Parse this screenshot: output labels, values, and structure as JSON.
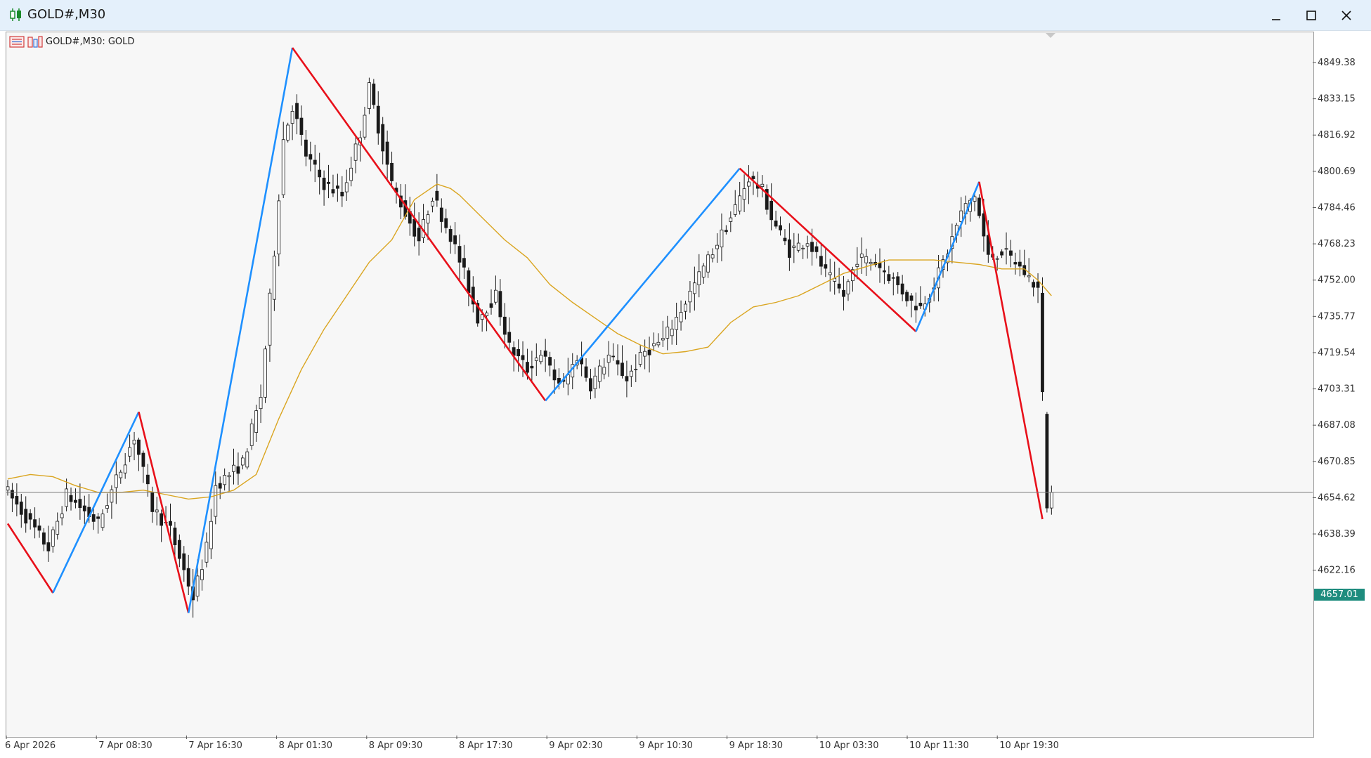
{
  "window": {
    "title": "GOLD#,M30",
    "icon": "candlestick-icon",
    "controls": [
      "minimize-icon",
      "maximize-icon",
      "close-icon"
    ]
  },
  "chart_header": {
    "label": "GOLD#,M30:  GOLD",
    "icons": [
      "one-click-trading-icon",
      "market-depth-icon"
    ]
  },
  "current_price": "4657.01",
  "colors": {
    "bull_body": "#ffffff",
    "bear_body": "#1a1a1a",
    "wick": "#1a1a1a",
    "zigzag_up": "#1e90ff",
    "zigzag_down": "#e8101a",
    "moving_average": "#daa520",
    "price_line": "#7a7a7a",
    "price_tag": "#1e8c7e",
    "background": "#f7f7f7"
  },
  "chart_data": {
    "type": "candlestick",
    "symbol": "GOLD#",
    "timeframe": "M30",
    "ylim": [
      4605,
      4859
    ],
    "y_ticks": [
      "4849.38",
      "4833.15",
      "4816.92",
      "4800.69",
      "4784.46",
      "4768.23",
      "4752.00",
      "4735.77",
      "4719.54",
      "4703.31",
      "4687.08",
      "4670.85",
      "4654.62",
      "4638.39",
      "4622.16"
    ],
    "x_ticks": [
      "6 Apr 2026",
      "7 Apr 08:30",
      "7 Apr 16:30",
      "8 Apr 01:30",
      "8 Apr 09:30",
      "8 Apr 17:30",
      "9 Apr 02:30",
      "9 Apr 10:30",
      "9 Apr 18:30",
      "10 Apr 03:30",
      "10 Apr 11:30",
      "10 Apr 19:30"
    ],
    "candle_count": 232,
    "close_path": [
      [
        0,
        4657
      ],
      [
        9,
        4632
      ],
      [
        13,
        4656
      ],
      [
        20,
        4643
      ],
      [
        28,
        4682
      ],
      [
        32,
        4650
      ],
      [
        36,
        4640
      ],
      [
        41,
        4610
      ],
      [
        44,
        4632
      ],
      [
        46,
        4660
      ],
      [
        52,
        4670
      ],
      [
        56,
        4700
      ],
      [
        59,
        4765
      ],
      [
        61,
        4815
      ],
      [
        63,
        4830
      ],
      [
        66,
        4808
      ],
      [
        70,
        4795
      ],
      [
        74,
        4790
      ],
      [
        78,
        4818
      ],
      [
        80,
        4838
      ],
      [
        83,
        4812
      ],
      [
        85,
        4795
      ],
      [
        88,
        4782
      ],
      [
        91,
        4770
      ],
      [
        94,
        4790
      ],
      [
        98,
        4772
      ],
      [
        101,
        4755
      ],
      [
        104,
        4735
      ],
      [
        108,
        4745
      ],
      [
        111,
        4722
      ],
      [
        115,
        4712
      ],
      [
        118,
        4720
      ],
      [
        121,
        4708
      ],
      [
        123,
        4705
      ],
      [
        126,
        4718
      ],
      [
        129,
        4705
      ],
      [
        133,
        4718
      ],
      [
        137,
        4708
      ],
      [
        141,
        4720
      ],
      [
        145,
        4725
      ],
      [
        148,
        4735
      ],
      [
        152,
        4750
      ],
      [
        156,
        4765
      ],
      [
        160,
        4780
      ],
      [
        164,
        4798
      ],
      [
        167,
        4792
      ],
      [
        169,
        4780
      ],
      [
        173,
        4765
      ],
      [
        177,
        4770
      ],
      [
        181,
        4755
      ],
      [
        185,
        4745
      ],
      [
        188,
        4762
      ],
      [
        192,
        4760
      ],
      [
        196,
        4752
      ],
      [
        200,
        4742
      ],
      [
        202,
        4740
      ],
      [
        205,
        4750
      ],
      [
        208,
        4765
      ],
      [
        211,
        4782
      ],
      [
        214,
        4790
      ],
      [
        217,
        4762
      ],
      [
        220,
        4765
      ],
      [
        223,
        4760
      ],
      [
        226,
        4753
      ],
      [
        228,
        4748
      ],
      [
        230,
        4652
      ],
      [
        231,
        4657
      ]
    ],
    "zigzag": [
      [
        0,
        4643
      ],
      [
        10,
        4612
      ],
      [
        29,
        4693
      ],
      [
        40,
        4603
      ],
      [
        63,
        4856
      ],
      [
        119,
        4698
      ],
      [
        162,
        4802
      ],
      [
        201,
        4729
      ],
      [
        215,
        4796
      ],
      [
        229,
        4645
      ]
    ],
    "moving_average": [
      [
        0,
        4663
      ],
      [
        5,
        4665
      ],
      [
        10,
        4664
      ],
      [
        15,
        4660
      ],
      [
        20,
        4657
      ],
      [
        25,
        4657
      ],
      [
        30,
        4658
      ],
      [
        35,
        4656
      ],
      [
        40,
        4654
      ],
      [
        45,
        4655
      ],
      [
        50,
        4658
      ],
      [
        55,
        4665
      ],
      [
        60,
        4690
      ],
      [
        65,
        4712
      ],
      [
        70,
        4730
      ],
      [
        75,
        4745
      ],
      [
        80,
        4760
      ],
      [
        85,
        4770
      ],
      [
        90,
        4788
      ],
      [
        95,
        4795
      ],
      [
        98,
        4793
      ],
      [
        100,
        4790
      ],
      [
        105,
        4780
      ],
      [
        110,
        4770
      ],
      [
        115,
        4762
      ],
      [
        120,
        4750
      ],
      [
        125,
        4742
      ],
      [
        130,
        4735
      ],
      [
        135,
        4728
      ],
      [
        140,
        4723
      ],
      [
        145,
        4719
      ],
      [
        150,
        4720
      ],
      [
        155,
        4722
      ],
      [
        160,
        4733
      ],
      [
        165,
        4740
      ],
      [
        170,
        4742
      ],
      [
        175,
        4745
      ],
      [
        180,
        4750
      ],
      [
        185,
        4755
      ],
      [
        190,
        4758
      ],
      [
        195,
        4761
      ],
      [
        200,
        4761
      ],
      [
        205,
        4761
      ],
      [
        210,
        4760
      ],
      [
        215,
        4759
      ],
      [
        220,
        4757
      ],
      [
        225,
        4757
      ],
      [
        228,
        4752
      ],
      [
        231,
        4745
      ]
    ]
  }
}
